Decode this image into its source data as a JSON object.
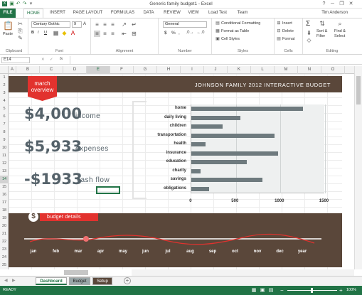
{
  "window": {
    "title": "Generic family budget1 - Excel",
    "help": "?",
    "minimize": "─",
    "restore": "❐",
    "close": "✕"
  },
  "tabs": [
    "FILE",
    "HOME",
    "INSERT",
    "PAGE LAYOUT",
    "FORMULAS",
    "DATA",
    "REVIEW",
    "VIEW",
    "Load Test",
    "Team"
  ],
  "user": "Tim Anderson",
  "ribbon": {
    "clipboard": {
      "label": "Clipboard",
      "paste": "Paste"
    },
    "font": {
      "label": "Font",
      "name": "Century Gothic",
      "size": "9",
      "bold": "B",
      "italic": "I",
      "underline": "U",
      "grow": "A",
      "shrink": "A"
    },
    "alignment": {
      "label": "Alignment"
    },
    "number": {
      "label": "Number",
      "format": "General",
      "currency": "$",
      "percent": "%",
      "comma": ","
    },
    "styles": {
      "label": "Styles",
      "conditional": "Conditional Formatting",
      "table": "Format as Table",
      "cell": "Cell Styles"
    },
    "cells": {
      "label": "Cells",
      "insert": "Insert",
      "delete": "Delete",
      "format": "Format"
    },
    "editing": {
      "label": "Editing",
      "sum": "Σ",
      "sort": "Sort &",
      "sort2": "Filter",
      "find": "Find &",
      "find2": "Select"
    }
  },
  "formula_bar": {
    "name_box": "E14",
    "fx": "fx",
    "cancel": "✕",
    "enter": "✓"
  },
  "columns": [
    "A",
    "B",
    "C",
    "D",
    "E",
    "F",
    "G",
    "H",
    "I",
    "J",
    "K",
    "L",
    "M",
    "N",
    "O"
  ],
  "selected_column": "E",
  "rows": [
    "1",
    "2",
    "3",
    "4",
    "5",
    "6",
    "7",
    "8",
    "9",
    "10",
    "11",
    "12",
    "13",
    "14",
    "15",
    "16",
    "17",
    "18",
    "19",
    "20",
    "21",
    "22",
    "23",
    "24",
    "25"
  ],
  "selected_row": "14",
  "dashboard": {
    "title": "JOHNSON FAMILY 2012 INTERACTIVE BUDGET",
    "month_line1": "march",
    "month_line2": "overview",
    "income_value": "$4,000",
    "income_label": "income",
    "expenses_value": "$5,933",
    "expenses_label": "expenses",
    "cashflow_value": "-$1933",
    "cashflow_label": "cash flow",
    "details_label": "budget details",
    "dollar_icon": "$",
    "months": [
      "jan",
      "feb",
      "mar",
      "apr",
      "may",
      "jun",
      "jul",
      "aug",
      "sep",
      "oct",
      "nov",
      "dec",
      "year"
    ],
    "selected_month": "mar"
  },
  "chart_data": {
    "type": "bar",
    "orientation": "horizontal",
    "categories": [
      "home",
      "daily living",
      "children",
      "transportation",
      "health",
      "insurance",
      "education",
      "charity",
      "savings",
      "obligations"
    ],
    "values": [
      1250,
      550,
      350,
      930,
      160,
      970,
      620,
      100,
      800,
      200
    ],
    "xlim": [
      0,
      1500
    ],
    "xticks": [
      "0",
      "500",
      "1000",
      "1500"
    ],
    "grid": true
  },
  "sheets": [
    "Dashboard",
    "Budget",
    "Setup"
  ],
  "active_sheet": "Dashboard",
  "add_sheet": "+",
  "status": {
    "ready": "READY",
    "zoom": "100%",
    "zoom_minus": "−",
    "zoom_plus": "+"
  }
}
